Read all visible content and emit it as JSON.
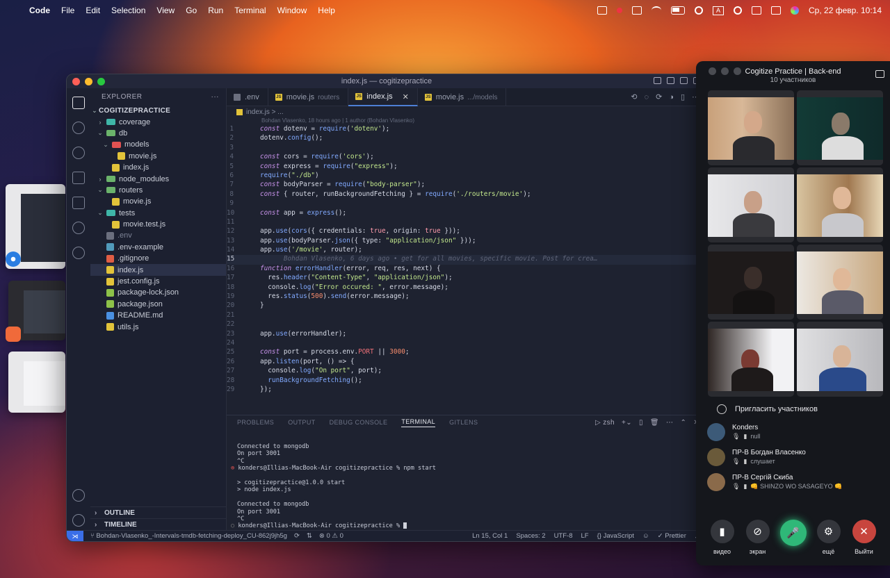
{
  "menubar": {
    "app": "Code",
    "items": [
      "File",
      "Edit",
      "Selection",
      "View",
      "Go",
      "Run",
      "Terminal",
      "Window",
      "Help"
    ],
    "clock": "Ср, 22 февр.  10:14",
    "input_lang": "A"
  },
  "vscode": {
    "title": "index.js — cogitizepractice",
    "explorer_label": "EXPLORER",
    "explorer_more": "···",
    "project": "COGITIZEPRACTICE",
    "tree": [
      {
        "label": "coverage",
        "kind": "folder",
        "open": false,
        "depth": 1
      },
      {
        "label": "db",
        "kind": "folder",
        "open": true,
        "depth": 1
      },
      {
        "label": "models",
        "kind": "folder",
        "open": true,
        "depth": 2
      },
      {
        "label": "movie.js",
        "kind": "js",
        "depth": 3
      },
      {
        "label": "index.js",
        "kind": "js",
        "depth": 2
      },
      {
        "label": "node_modules",
        "kind": "folder",
        "open": false,
        "depth": 1
      },
      {
        "label": "routers",
        "kind": "folder",
        "open": true,
        "depth": 1
      },
      {
        "label": "movie.js",
        "kind": "js",
        "depth": 2
      },
      {
        "label": "tests",
        "kind": "folder",
        "open": true,
        "depth": 1
      },
      {
        "label": "movie.test.js",
        "kind": "test",
        "depth": 2
      },
      {
        "label": ".env",
        "kind": "env",
        "depth": 1,
        "dim": true
      },
      {
        "label": ".env-example",
        "kind": "file",
        "depth": 1
      },
      {
        "label": ".gitignore",
        "kind": "git",
        "depth": 1
      },
      {
        "label": "index.js",
        "kind": "js",
        "depth": 1,
        "active": true
      },
      {
        "label": "jest.config.js",
        "kind": "js",
        "depth": 1
      },
      {
        "label": "package-lock.json",
        "kind": "json",
        "depth": 1
      },
      {
        "label": "package.json",
        "kind": "json",
        "depth": 1
      },
      {
        "label": "README.md",
        "kind": "info",
        "depth": 1
      },
      {
        "label": "utils.js",
        "kind": "js",
        "depth": 1
      }
    ],
    "outline_label": "OUTLINE",
    "timeline_label": "TIMELINE",
    "tabs": [
      {
        "label": ".env",
        "sub": "",
        "active": false,
        "icon": "env"
      },
      {
        "label": "movie.js",
        "sub": "routers",
        "active": false,
        "icon": "js"
      },
      {
        "label": "index.js",
        "sub": "",
        "active": true,
        "icon": "js"
      },
      {
        "label": "movie.js",
        "sub": ".../models",
        "active": false,
        "icon": "js"
      }
    ],
    "tab_close": "✕",
    "breadcrumb": "index.js > ...",
    "blame": "Bohdan Vlasenko, 18 hours ago | 1 author (Bohdan Vlasenko)",
    "current_line": 15,
    "code_lines": [
      "const dotenv = require('dotenv');",
      "dotenv.config();",
      "",
      "const cors = require('cors');",
      "const express = require(\"express\");",
      "require(\"./db\")",
      "const bodyParser = require(\"body-parser\");",
      "const { router, runBackgroundFetching } = require('./routers/movie');",
      "",
      "const app = express();",
      "",
      "app.use(cors({ credentials: true, origin: true }));",
      "app.use(bodyParser.json({ type: \"application/json\" }));",
      "app.use('/movie', router);",
      "",
      "function errorHandler(error, req, res, next) {",
      "  res.header(\"Content-Type\", \"application/json\");",
      "  console.log(\"Error occured: \", error.message);",
      "  res.status(500).send(error.message);",
      "}",
      "",
      "",
      "app.use(errorHandler);",
      "",
      "const port = process.env.PORT || 3000;",
      "app.listen(port, () => {",
      "  console.log(\"On port\", port);",
      "  runBackgroundFetching();",
      "});"
    ],
    "ghost_text": "Bohdan Vlasenko, 6 days ago • get for all movies, specific movie. Post for crea…",
    "panel_tabs": [
      "PROBLEMS",
      "OUTPUT",
      "DEBUG CONSOLE",
      "TERMINAL",
      "GITLENS"
    ],
    "panel_active": "TERMINAL",
    "shell": "zsh",
    "terminal": [
      "Connected to mongodb",
      "On port 3001",
      "^C",
      "konders@Illias-MacBook-Air cogitizepractice % npm start",
      "",
      "> cogitizepractice@1.0.0 start",
      "> node index.js",
      "",
      "Connected to mongodb",
      "On port 3001",
      "^C",
      "konders@Illias-MacBook-Air cogitizepractice % "
    ],
    "status": {
      "branch": "Bohdan-Vlasenko_-Intervals-tmdb-fetching-deploy_CU-862j9jh5g",
      "problems": "⊗ 0 ⚠ 0",
      "position": "Ln 15, Col 1",
      "spaces": "Spaces: 2",
      "encoding": "UTF-8",
      "eol": "LF",
      "language": "JavaScript",
      "formatter": "Prettier"
    }
  },
  "call": {
    "title": "Cogitize Practice | Back-end",
    "subtitle": "10 участников",
    "invite": "Пригласить участников",
    "participants": [
      {
        "name": "Konders",
        "status": "null",
        "avatar_color": "#3c5a78"
      },
      {
        "name": "ПР-В Богдан Власенко",
        "status": "слушает",
        "avatar_color": "#6a5a3a"
      },
      {
        "name": "ПР-В Сергій Скиба",
        "status": "👊 SHINZO WO SASAGEYO 👊",
        "avatar_color": "#8a6a4a"
      }
    ],
    "buttons": [
      {
        "label": "видео",
        "color": "#34363c",
        "glyph": "▮"
      },
      {
        "label": "экран",
        "color": "#34363c",
        "glyph": "⊘"
      },
      {
        "label": "",
        "color": "#2fb878",
        "glyph": "🎤"
      },
      {
        "label": "ещё",
        "color": "#34363c",
        "glyph": "⚙"
      },
      {
        "label": "Выйти",
        "color": "#c8453e",
        "glyph": "✕"
      }
    ]
  }
}
